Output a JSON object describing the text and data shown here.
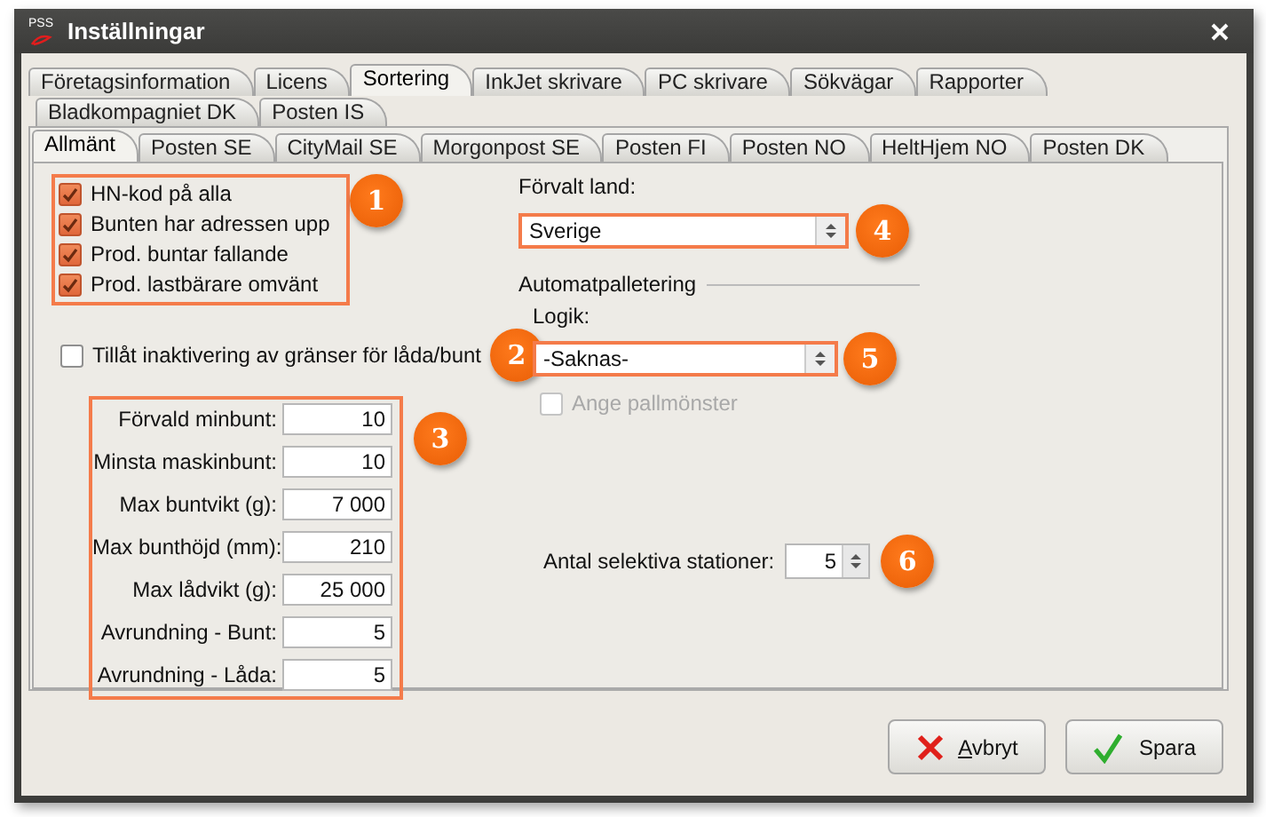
{
  "window": {
    "logo_text": "PSS",
    "title": "Inställningar"
  },
  "tab_rows": [
    [
      {
        "label": "Företagsinformation",
        "selected": false
      },
      {
        "label": "Licens",
        "selected": false
      },
      {
        "label": "Sortering",
        "selected": true
      },
      {
        "label": "InkJet skrivare",
        "selected": false
      },
      {
        "label": "PC skrivare",
        "selected": false
      },
      {
        "label": "Sökvägar",
        "selected": false
      },
      {
        "label": "Rapporter",
        "selected": false
      }
    ],
    [
      {
        "label": "Bladkompagniet DK",
        "selected": false
      },
      {
        "label": "Posten IS",
        "selected": false
      }
    ]
  ],
  "subtabs": [
    {
      "label": "Allmänt",
      "selected": true
    },
    {
      "label": "Posten SE",
      "selected": false
    },
    {
      "label": "CityMail SE",
      "selected": false
    },
    {
      "label": "Morgonpost SE",
      "selected": false
    },
    {
      "label": "Posten FI",
      "selected": false
    },
    {
      "label": "Posten NO",
      "selected": false
    },
    {
      "label": "HeltHjem NO",
      "selected": false
    },
    {
      "label": "Posten DK",
      "selected": false
    }
  ],
  "options": {
    "annotation": "1",
    "items": [
      {
        "label": "HN-kod på alla",
        "checked": true
      },
      {
        "label": "Bunten har adressen upp",
        "checked": true
      },
      {
        "label": "Prod. buntar fallande",
        "checked": true
      },
      {
        "label": "Prod. lastbärare omvänt",
        "checked": true
      }
    ]
  },
  "limit_toggle": {
    "label": "Tillåt inaktivering av gränser för låda/bunt",
    "checked": false,
    "annotation": "2"
  },
  "limits": {
    "annotation": "3",
    "fields": [
      {
        "label": "Förvald minbunt:",
        "value": "10"
      },
      {
        "label": "Minsta maskinbunt:",
        "value": "10"
      },
      {
        "label": "Max buntvikt (g):",
        "value": "7 000"
      },
      {
        "label": "Max bunthöjd (mm):",
        "value": "210"
      },
      {
        "label": "Max lådvikt (g):",
        "value": "25 000"
      },
      {
        "label": "Avrundning - Bunt:",
        "value": "5"
      },
      {
        "label": "Avrundning - Låda:",
        "value": "5"
      }
    ]
  },
  "default_country": {
    "label": "Förvalt land:",
    "value": "Sverige",
    "annotation": "4"
  },
  "palletizing": {
    "title": "Automatpalletering",
    "logic_label": "Logik:",
    "logic_value": "-Saknas-",
    "annotation": "5",
    "pattern": {
      "label": "Ange pallmönster",
      "checked": false,
      "disabled": true
    }
  },
  "stations": {
    "label": "Antal selektiva stationer:",
    "value": "5",
    "annotation": "6"
  },
  "buttons": [
    {
      "kind": "cancel",
      "label": "Avbryt"
    },
    {
      "kind": "save",
      "label": "Spara"
    }
  ]
}
